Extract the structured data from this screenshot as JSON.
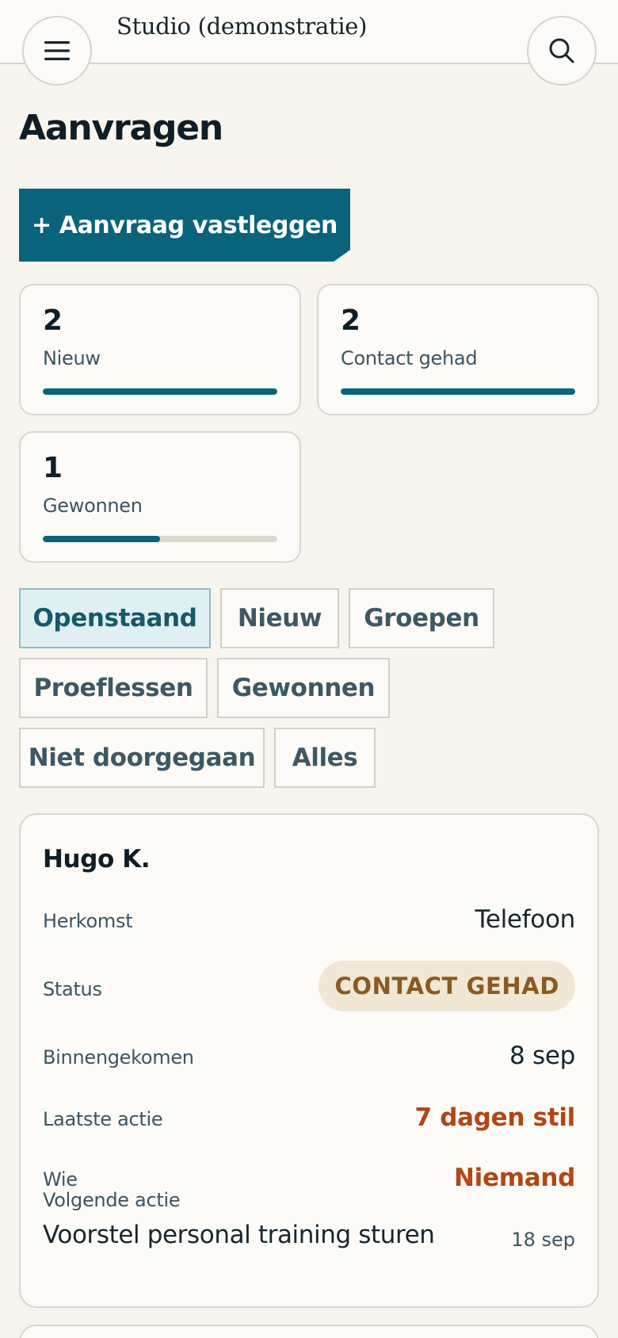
{
  "header": {
    "app_title": "Studio (demonstratie)",
    "menu_icon": "hamburger-menu-icon",
    "search_icon": "search-icon"
  },
  "page": {
    "title": "Aanvragen",
    "add_button_label": "+ Aanvraag vastleggen"
  },
  "stats": [
    {
      "count": "2",
      "label": "Nieuw",
      "progress": 1.0
    },
    {
      "count": "2",
      "label": "Contact gehad",
      "progress": 1.0
    },
    {
      "count": "1",
      "label": "Gewonnen",
      "progress": 0.5
    }
  ],
  "filters": [
    {
      "label": "Openstaand",
      "active": true
    },
    {
      "label": "Nieuw",
      "active": false
    },
    {
      "label": "Groepen",
      "active": false
    },
    {
      "label": "Proeflessen",
      "active": false
    },
    {
      "label": "Gewonnen",
      "active": false
    },
    {
      "label": "Niet doorgegaan",
      "active": false
    },
    {
      "label": "Alles",
      "active": false
    }
  ],
  "lead": {
    "name": "Hugo K.",
    "origin_label": "Herkomst",
    "origin_value": "Telefoon",
    "status_label": "Status",
    "status_value": "CONTACT GEHAD",
    "received_label": "Binnengekomen",
    "received_value": "8 sep",
    "last_action_label": "Laatste actie",
    "last_action_value": "7 dagen stil",
    "who_label": "Wie",
    "who_value": "Niemand",
    "next_action_label": "Volgende actie",
    "next_action_value": "Voorstel personal training sturen",
    "next_action_date": "18 sep"
  },
  "colors": {
    "accent": "#09637a",
    "warning": "#b24614",
    "status_pill_bg": "#f1e7d5",
    "status_pill_text": "#8a5a1f",
    "background": "#f8f5ef"
  }
}
